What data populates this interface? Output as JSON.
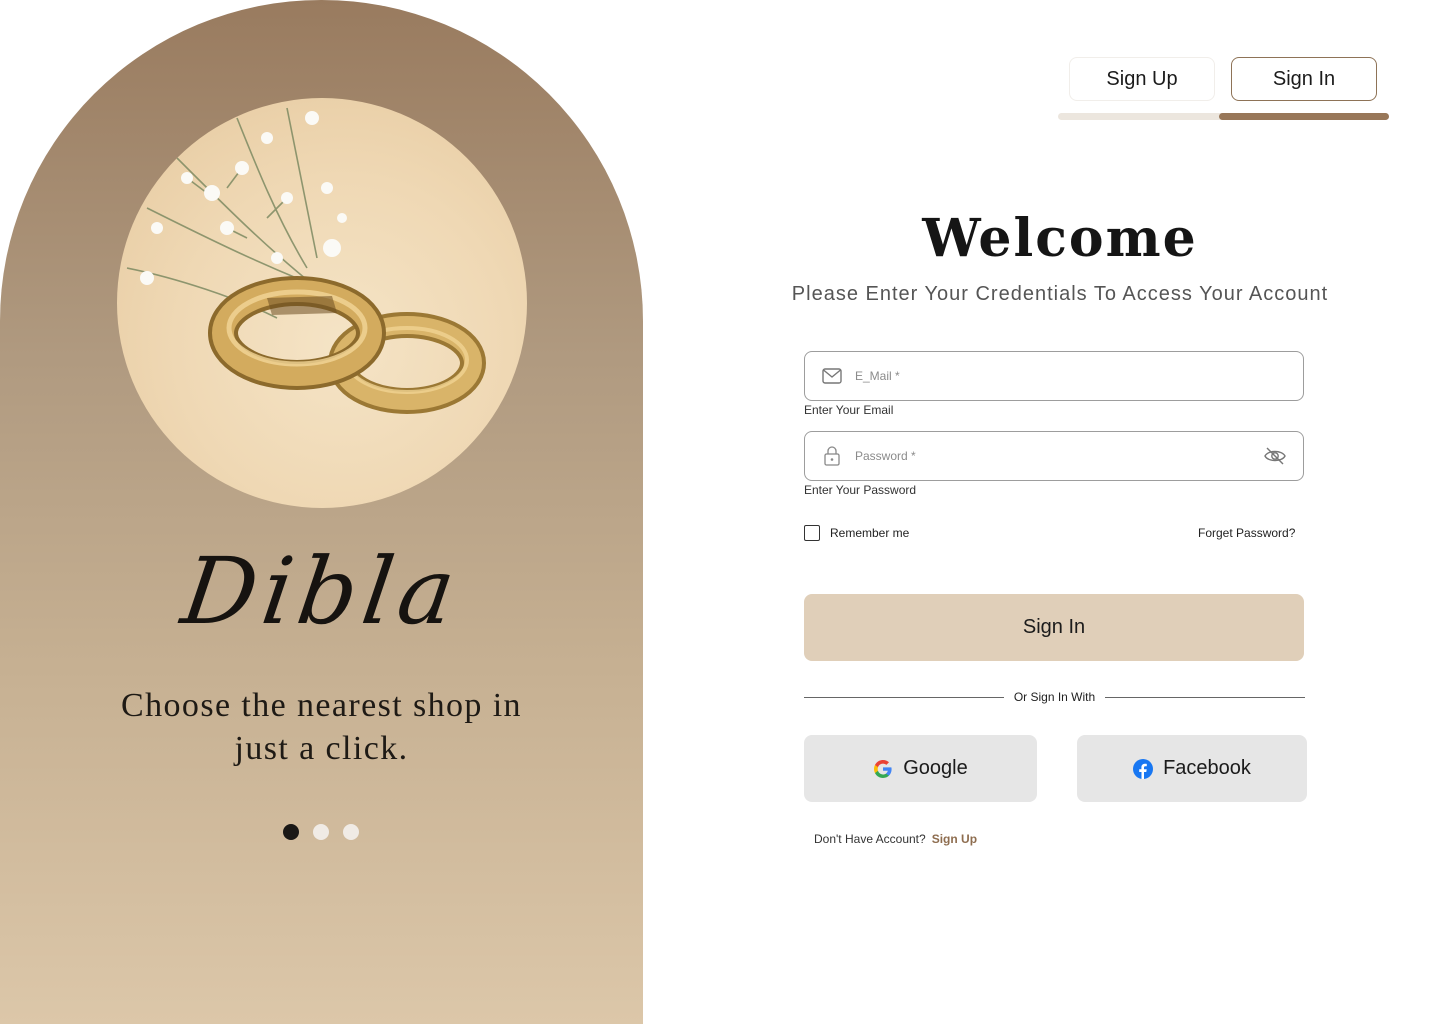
{
  "hero": {
    "brand": "Dibla",
    "tagline": "Choose the nearest shop in just a click.",
    "carousel": {
      "count": 3,
      "active_index": 0
    }
  },
  "tabs": {
    "signup": "Sign Up",
    "signin": "Sign In",
    "active": "signin"
  },
  "form": {
    "title": "Welcome",
    "subtitle": "Please Enter Your Credentials To Access Your Account",
    "email": {
      "placeholder": "E_Mail *",
      "helper": "Enter Your Email",
      "icon": "mail-icon"
    },
    "password": {
      "placeholder": "Password *",
      "helper": "Enter Your Password",
      "icon": "lock-icon",
      "toggle_icon": "eye-off-icon"
    },
    "remember": {
      "label": "Remember me",
      "checked": false
    },
    "forgot": "Forget Password?",
    "submit": "Sign In",
    "divider": "Or Sign In With",
    "social": {
      "google": "Google",
      "facebook": "Facebook"
    },
    "footer": {
      "prompt": "Don't Have Account?",
      "link": "Sign Up"
    }
  },
  "colors": {
    "accent": "#987759",
    "button_bg": "#e0cfb9",
    "social_bg": "#e6e6e6",
    "link": "#8e6d4f"
  }
}
